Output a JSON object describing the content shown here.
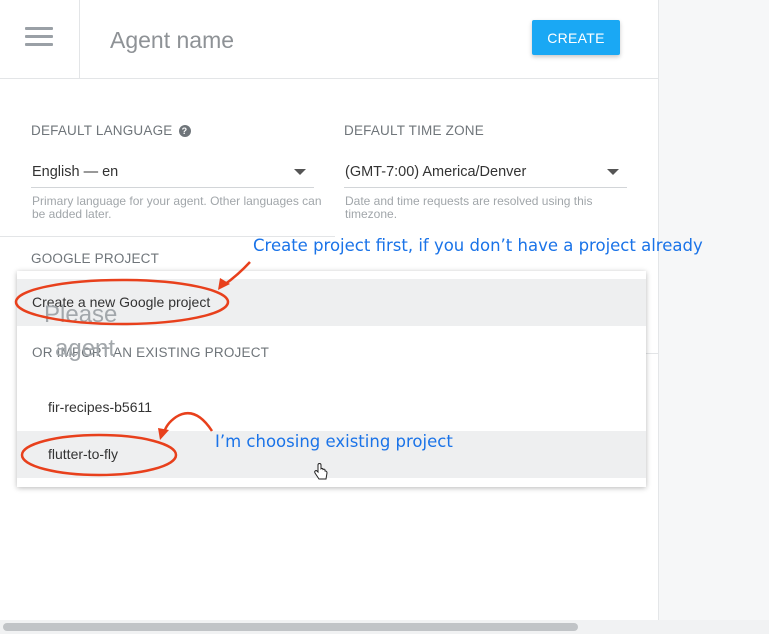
{
  "header": {
    "agent_name_placeholder": "Agent name",
    "create_label": "CREATE"
  },
  "language": {
    "label": "DEFAULT LANGUAGE",
    "help_icon": "?",
    "value": "English — en",
    "hint": "Primary language for your agent. Other languages can be added later."
  },
  "timezone": {
    "label": "DEFAULT TIME ZONE",
    "value": "(GMT-7:00) America/Denver",
    "hint": "Date and time requests are resolved using this timezone."
  },
  "google_project": {
    "label": "GOOGLE PROJECT",
    "create_option": "Create a new Google project",
    "import_header": "OR IMPORT AN EXISTING PROJECT",
    "projects": [
      "fir-recipes-b5611",
      "flutter-to-fly"
    ]
  },
  "right_panel": {
    "line1": "Please",
    "line2": "agent"
  },
  "annotations": {
    "create_note": "Create project first, if you don’t have a project already",
    "choose_note": "I’m choosing existing project",
    "color": "#1a73e8",
    "arrow_color": "#e8401c"
  },
  "icons": [
    "hamburger-menu-icon",
    "help-icon",
    "dropdown-caret-icon",
    "hand-pointer-icon"
  ]
}
